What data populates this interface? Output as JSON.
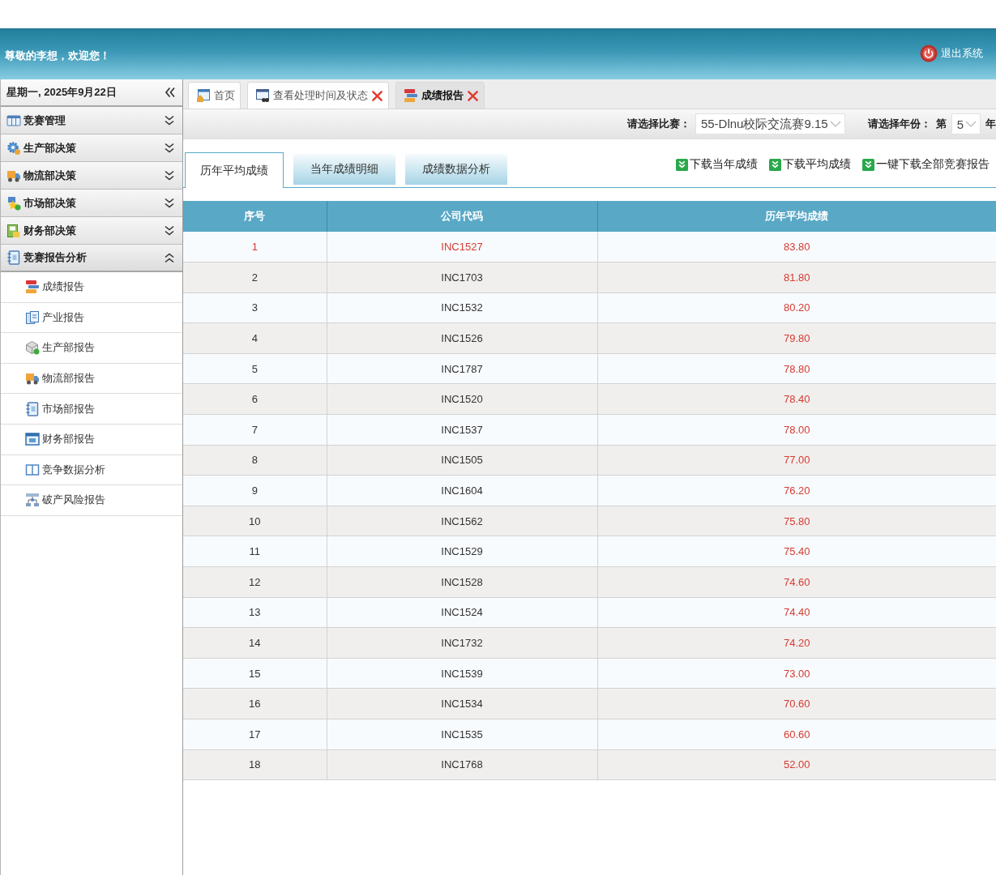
{
  "header": {
    "welcome": "尊敬的李想，欢迎您！",
    "logout": "退出系统"
  },
  "sidebar": {
    "date": "星期一, 2025年9月22日",
    "sections": [
      {
        "label": "竞赛管理",
        "expanded": false
      },
      {
        "label": "生产部决策",
        "expanded": false
      },
      {
        "label": "物流部决策",
        "expanded": false
      },
      {
        "label": "市场部决策",
        "expanded": false
      },
      {
        "label": "财务部决策",
        "expanded": false
      },
      {
        "label": "竞赛报告分析",
        "expanded": true,
        "items": [
          "成绩报告",
          "产业报告",
          "生产部报告",
          "物流部报告",
          "市场部报告",
          "财务部报告",
          "竞争数据分析",
          "破产风险报告"
        ]
      }
    ]
  },
  "tabs": [
    {
      "label": "首页",
      "selected": false,
      "closable": false
    },
    {
      "label": "查看处理时间及状态",
      "selected": false,
      "closable": true
    },
    {
      "label": "成绩报告",
      "selected": true,
      "closable": true
    }
  ],
  "filters": [
    {
      "label": "请选择比赛：",
      "value": "55-Dlnu校际交流赛9.15"
    },
    {
      "label": "请选择年份：",
      "prefix": "第",
      "value": "5",
      "suffix": "年"
    }
  ],
  "report_tabs": [
    {
      "label": "历年平均成绩",
      "selected": true
    },
    {
      "label": "当年成绩明细",
      "selected": false
    },
    {
      "label": "成绩数据分析",
      "selected": false
    }
  ],
  "downloads": [
    "下载当年成绩",
    "下载平均成绩",
    "一键下载全部竞赛报告"
  ],
  "table": {
    "columns": [
      "序号",
      "公司代码",
      "历年平均成绩"
    ],
    "rows": [
      {
        "cells": [
          "1",
          "INC1527",
          "83.80"
        ],
        "highlighted": true
      },
      {
        "cells": [
          "2",
          "INC1703",
          "81.80"
        ],
        "highlighted": false
      },
      {
        "cells": [
          "3",
          "INC1532",
          "80.20"
        ],
        "highlighted": false
      },
      {
        "cells": [
          "4",
          "INC1526",
          "79.80"
        ],
        "highlighted": false
      },
      {
        "cells": [
          "5",
          "INC1787",
          "78.80"
        ],
        "highlighted": false
      },
      {
        "cells": [
          "6",
          "INC1520",
          "78.40"
        ],
        "highlighted": false
      },
      {
        "cells": [
          "7",
          "INC1537",
          "78.00"
        ],
        "highlighted": false
      },
      {
        "cells": [
          "8",
          "INC1505",
          "77.00"
        ],
        "highlighted": false
      },
      {
        "cells": [
          "9",
          "INC1604",
          "76.20"
        ],
        "highlighted": false
      },
      {
        "cells": [
          "10",
          "INC1562",
          "75.80"
        ],
        "highlighted": false
      },
      {
        "cells": [
          "11",
          "INC1529",
          "75.40"
        ],
        "highlighted": false
      },
      {
        "cells": [
          "12",
          "INC1528",
          "74.60"
        ],
        "highlighted": false
      },
      {
        "cells": [
          "13",
          "INC1524",
          "74.40"
        ],
        "highlighted": false
      },
      {
        "cells": [
          "14",
          "INC1732",
          "74.20"
        ],
        "highlighted": false
      },
      {
        "cells": [
          "15",
          "INC1539",
          "73.00"
        ],
        "highlighted": false
      },
      {
        "cells": [
          "16",
          "INC1534",
          "70.60"
        ],
        "highlighted": false
      },
      {
        "cells": [
          "17",
          "INC1535",
          "60.60"
        ],
        "highlighted": false
      },
      {
        "cells": [
          "18",
          "INC1768",
          "52.00"
        ],
        "highlighted": false
      }
    ]
  }
}
